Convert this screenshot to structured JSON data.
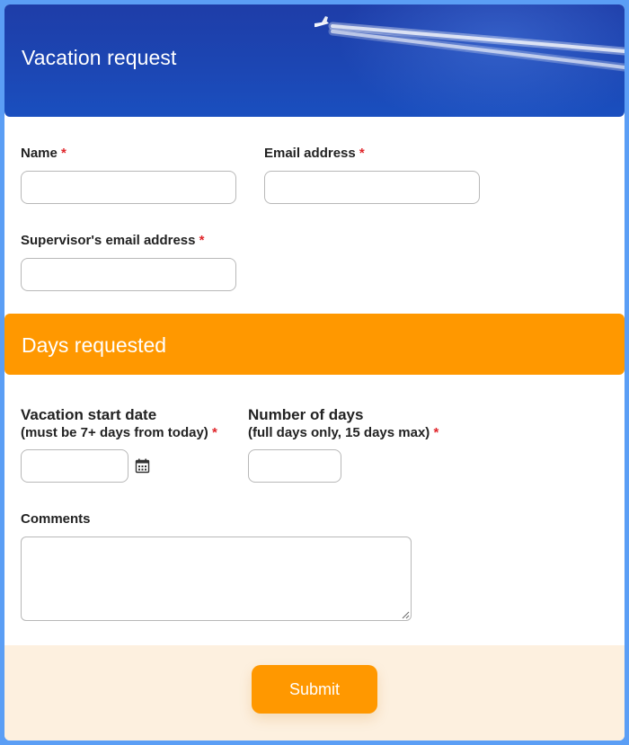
{
  "header": {
    "title": "Vacation request"
  },
  "fields": {
    "name": {
      "label": "Name",
      "required_mark": "*"
    },
    "email": {
      "label": "Email address",
      "required_mark": "*"
    },
    "supervisor_email": {
      "label": "Supervisor's email address",
      "required_mark": "*"
    }
  },
  "section": {
    "title": "Days requested"
  },
  "days": {
    "start_date": {
      "label": "Vacation start date",
      "sublabel": "(must be 7+ days from today)",
      "required_mark": "*",
      "icon": "calendar-icon"
    },
    "num_days": {
      "label": "Number of days",
      "sublabel": "(full days only, 15 days max)",
      "required_mark": "*"
    },
    "comments": {
      "label": "Comments"
    }
  },
  "footer": {
    "submit_label": "Submit"
  },
  "colors": {
    "hero": "#1c46b3",
    "accent": "#ff9800",
    "required": "#e0262b",
    "footer_bg": "#fdf0df",
    "frame": "#5b9ef5"
  }
}
